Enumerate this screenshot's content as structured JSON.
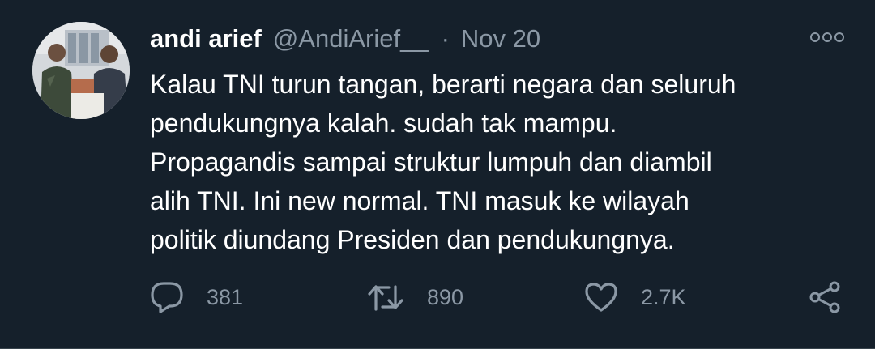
{
  "tweet": {
    "display_name": "andi arief",
    "handle": "@AndiArief__",
    "separator": "·",
    "date": "Nov 20",
    "body_lines": [
      "Kalau TNI turun tangan, berarti negara dan seluruh",
      "pendukungnya kalah. sudah tak mampu.",
      "Propagandis sampai struktur lumpuh dan diambil",
      "alih TNI. Ini new normal. TNI masuk ke wilayah",
      "politik diundang Presiden dan pendukungnya."
    ],
    "actions": {
      "reply_count": "381",
      "retweet_count": "890",
      "like_count": "2.7K"
    },
    "icons": {
      "reply": "reply-icon",
      "retweet": "retweet-icon",
      "like": "heart-icon",
      "share": "share-icon",
      "more": "more-options-icon"
    },
    "colors": {
      "background": "#15202b",
      "text": "#ffffff",
      "secondary": "#8b98a5"
    }
  }
}
